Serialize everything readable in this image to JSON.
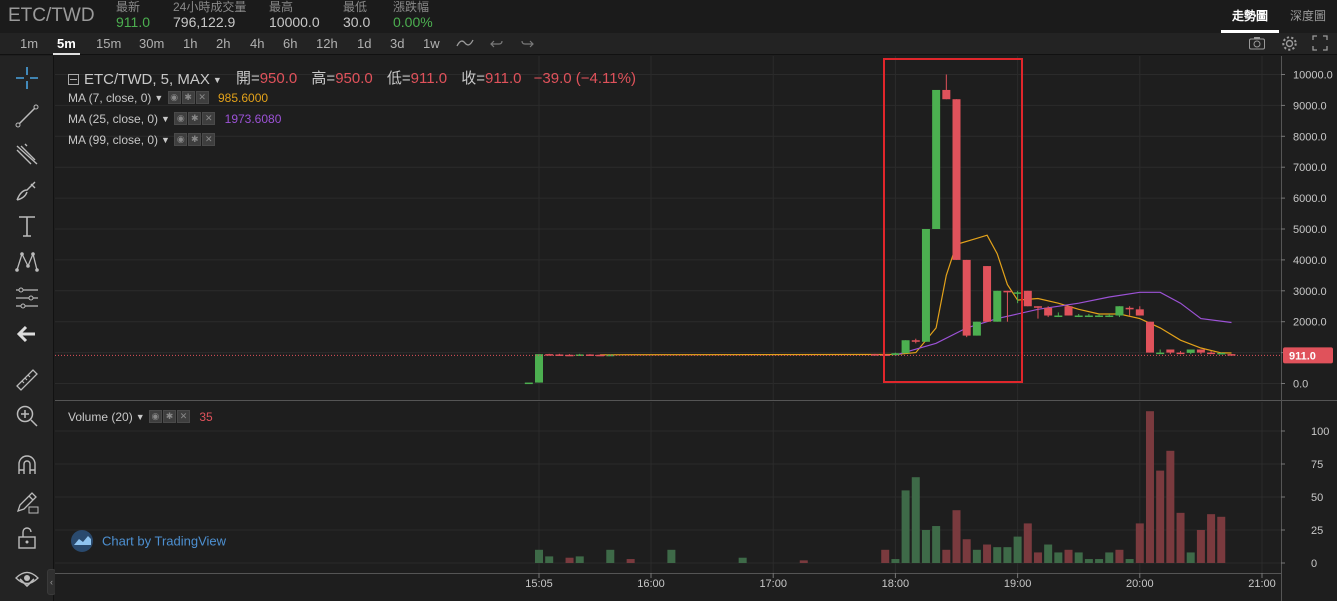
{
  "header": {
    "pair": "ETC/TWD",
    "stats": [
      {
        "label": "最新",
        "value": "911.0",
        "tone": "up"
      },
      {
        "label": "24小時成交量",
        "value": "796,122.9",
        "tone": ""
      },
      {
        "label": "最高",
        "value": "10000.0",
        "tone": ""
      },
      {
        "label": "最低",
        "value": "30.0",
        "tone": ""
      },
      {
        "label": "漲跌幅",
        "value": "0.00%",
        "tone": "up"
      }
    ],
    "view_tabs": [
      "走勢圖",
      "深度圖"
    ],
    "active_view": "走勢圖"
  },
  "toolbar": {
    "timeframes": [
      "1m",
      "5m",
      "15m",
      "30m",
      "1h",
      "2h",
      "4h",
      "6h",
      "12h",
      "1d",
      "3d",
      "1w"
    ],
    "active_timeframe": "5m"
  },
  "left_tools": [
    "crosshair-icon",
    "trend-line-icon",
    "pitchfork-icon",
    "brush-icon",
    "text-icon",
    "pattern-icon",
    "fib-icon",
    "back-arrow-icon",
    "ruler-icon",
    "zoom-in-icon",
    "magnet-icon",
    "lock-pencil-icon",
    "unlock-icon",
    "eye-icon"
  ],
  "legend": {
    "title": "ETC/TWD, 5, MAX",
    "open_label": "開=",
    "open": "950.0",
    "high_label": "高=",
    "high": "950.0",
    "low_label": "低=",
    "low": "911.0",
    "close_label": "收=",
    "close": "911.0",
    "change": "−39.0 (−4.11%)",
    "ma7_label": "MA (7, close, 0)",
    "ma7_value": "985.6000",
    "ma25_label": "MA (25, close, 0)",
    "ma25_value": "1973.6080",
    "ma99_label": "MA (99, close, 0)",
    "volume_label": "Volume (20)",
    "volume_value": "35"
  },
  "watermark": "Chart by TradingView",
  "colors": {
    "up": "#4caf50",
    "down": "#e0525b",
    "ma7": "#e3a21a",
    "ma25": "#9c52d6",
    "up_vol": "#3e6a48",
    "down_vol": "#7a3a3e",
    "highlight": "#e0262b"
  },
  "chart_data": {
    "type": "candlestick",
    "price_axis": {
      "ticks": [
        0,
        1000,
        2000,
        3000,
        4000,
        5000,
        6000,
        7000,
        8000,
        9000,
        10000
      ],
      "tick_labels": [
        "0.0",
        "1000.0",
        "2000.0",
        "3000.0",
        "4000.0",
        "5000.0",
        "6000.0",
        "7000.0",
        "8000.0",
        "9000.0",
        "10000.0"
      ],
      "last_price": "911.0"
    },
    "volume_axis": {
      "ticks": [
        0,
        25,
        50,
        75,
        100
      ],
      "tick_labels": [
        "0",
        "25",
        "50",
        "75",
        "100"
      ]
    },
    "time_axis": {
      "ticks": [
        "15:05",
        "16:00",
        "17:00",
        "18:00",
        "19:00",
        "20:00",
        "21:00"
      ],
      "tick_minutes": [
        905,
        960,
        1020,
        1080,
        1140,
        1200,
        1260
      ]
    },
    "candles": [
      {
        "t": 900,
        "o": 30,
        "h": 30,
        "l": 30,
        "c": 30
      },
      {
        "t": 905,
        "o": 30,
        "h": 950,
        "l": 30,
        "c": 950
      },
      {
        "t": 910,
        "o": 950,
        "h": 960,
        "l": 900,
        "c": 940
      },
      {
        "t": 915,
        "o": 940,
        "h": 960,
        "l": 920,
        "c": 930
      },
      {
        "t": 920,
        "o": 930,
        "h": 950,
        "l": 900,
        "c": 920
      },
      {
        "t": 925,
        "o": 920,
        "h": 960,
        "l": 910,
        "c": 940
      },
      {
        "t": 930,
        "o": 940,
        "h": 950,
        "l": 920,
        "c": 930
      },
      {
        "t": 935,
        "o": 930,
        "h": 940,
        "l": 920,
        "c": 925
      },
      {
        "t": 940,
        "o": 925,
        "h": 935,
        "l": 915,
        "c": 930
      },
      {
        "t": 1070,
        "o": 950,
        "h": 960,
        "l": 930,
        "c": 940
      },
      {
        "t": 1075,
        "o": 940,
        "h": 950,
        "l": 910,
        "c": 920
      },
      {
        "t": 1080,
        "o": 920,
        "h": 1000,
        "l": 920,
        "c": 980
      },
      {
        "t": 1085,
        "o": 980,
        "h": 1400,
        "l": 980,
        "c": 1400
      },
      {
        "t": 1090,
        "o": 1400,
        "h": 1450,
        "l": 1300,
        "c": 1350
      },
      {
        "t": 1095,
        "o": 1350,
        "h": 5000,
        "l": 1350,
        "c": 5000
      },
      {
        "t": 1100,
        "o": 5000,
        "h": 9500,
        "l": 5000,
        "c": 9500
      },
      {
        "t": 1105,
        "o": 9500,
        "h": 10000,
        "l": 9200,
        "c": 9200
      },
      {
        "t": 1110,
        "o": 9200,
        "h": 9200,
        "l": 4000,
        "c": 4000
      },
      {
        "t": 1115,
        "o": 4000,
        "h": 4000,
        "l": 1500,
        "c": 1550
      },
      {
        "t": 1120,
        "o": 1550,
        "h": 2000,
        "l": 1550,
        "c": 2000
      },
      {
        "t": 1125,
        "o": 3800,
        "h": 3800,
        "l": 2000,
        "c": 2000
      },
      {
        "t": 1130,
        "o": 2000,
        "h": 3000,
        "l": 2000,
        "c": 3000
      },
      {
        "t": 1135,
        "o": 3000,
        "h": 3000,
        "l": 2000,
        "c": 2950
      },
      {
        "t": 1140,
        "o": 2950,
        "h": 3000,
        "l": 2600,
        "c": 2950
      },
      {
        "t": 1145,
        "o": 3000,
        "h": 3000,
        "l": 2500,
        "c": 2500
      },
      {
        "t": 1150,
        "o": 2500,
        "h": 2500,
        "l": 2100,
        "c": 2450
      },
      {
        "t": 1155,
        "o": 2450,
        "h": 2500,
        "l": 2150,
        "c": 2200
      },
      {
        "t": 1160,
        "o": 2200,
        "h": 2300,
        "l": 2150,
        "c": 2200
      },
      {
        "t": 1165,
        "o": 2500,
        "h": 2500,
        "l": 2200,
        "c": 2200
      },
      {
        "t": 1170,
        "o": 2200,
        "h": 2250,
        "l": 2150,
        "c": 2200
      },
      {
        "t": 1175,
        "o": 2200,
        "h": 2250,
        "l": 2150,
        "c": 2200
      },
      {
        "t": 1180,
        "o": 2200,
        "h": 2250,
        "l": 2150,
        "c": 2200
      },
      {
        "t": 1185,
        "o": 2200,
        "h": 2250,
        "l": 2150,
        "c": 2200
      },
      {
        "t": 1190,
        "o": 2200,
        "h": 2500,
        "l": 2150,
        "c": 2500
      },
      {
        "t": 1195,
        "o": 2450,
        "h": 2500,
        "l": 2200,
        "c": 2400
      },
      {
        "t": 1200,
        "o": 2400,
        "h": 2500,
        "l": 2200,
        "c": 2200
      },
      {
        "t": 1205,
        "o": 2000,
        "h": 2000,
        "l": 1000,
        "c": 1000
      },
      {
        "t": 1210,
        "o": 1000,
        "h": 1100,
        "l": 950,
        "c": 1000
      },
      {
        "t": 1215,
        "o": 1100,
        "h": 1100,
        "l": 950,
        "c": 1000
      },
      {
        "t": 1220,
        "o": 1000,
        "h": 1050,
        "l": 950,
        "c": 990
      },
      {
        "t": 1225,
        "o": 990,
        "h": 1100,
        "l": 950,
        "c": 1100
      },
      {
        "t": 1230,
        "o": 1100,
        "h": 1100,
        "l": 950,
        "c": 1000
      },
      {
        "t": 1235,
        "o": 1000,
        "h": 1050,
        "l": 950,
        "c": 980
      },
      {
        "t": 1240,
        "o": 980,
        "h": 1000,
        "l": 950,
        "c": 990
      },
      {
        "t": 1245,
        "o": 950,
        "h": 950,
        "l": 911,
        "c": 911
      }
    ],
    "volume": [
      {
        "t": 905,
        "v": 10,
        "dir": "up"
      },
      {
        "t": 910,
        "v": 5,
        "dir": "up"
      },
      {
        "t": 920,
        "v": 4,
        "dir": "down"
      },
      {
        "t": 925,
        "v": 5,
        "dir": "up"
      },
      {
        "t": 940,
        "v": 10,
        "dir": "up"
      },
      {
        "t": 950,
        "v": 3,
        "dir": "down"
      },
      {
        "t": 970,
        "v": 10,
        "dir": "up"
      },
      {
        "t": 1005,
        "v": 4,
        "dir": "up"
      },
      {
        "t": 1035,
        "v": 2,
        "dir": "down"
      },
      {
        "t": 1075,
        "v": 10,
        "dir": "down"
      },
      {
        "t": 1080,
        "v": 3,
        "dir": "up"
      },
      {
        "t": 1085,
        "v": 55,
        "dir": "up"
      },
      {
        "t": 1090,
        "v": 65,
        "dir": "up"
      },
      {
        "t": 1095,
        "v": 25,
        "dir": "up"
      },
      {
        "t": 1100,
        "v": 28,
        "dir": "up"
      },
      {
        "t": 1105,
        "v": 10,
        "dir": "down"
      },
      {
        "t": 1110,
        "v": 40,
        "dir": "down"
      },
      {
        "t": 1115,
        "v": 18,
        "dir": "down"
      },
      {
        "t": 1120,
        "v": 10,
        "dir": "up"
      },
      {
        "t": 1125,
        "v": 14,
        "dir": "down"
      },
      {
        "t": 1130,
        "v": 12,
        "dir": "up"
      },
      {
        "t": 1135,
        "v": 12,
        "dir": "up"
      },
      {
        "t": 1140,
        "v": 20,
        "dir": "up"
      },
      {
        "t": 1145,
        "v": 30,
        "dir": "down"
      },
      {
        "t": 1150,
        "v": 8,
        "dir": "down"
      },
      {
        "t": 1155,
        "v": 14,
        "dir": "up"
      },
      {
        "t": 1160,
        "v": 8,
        "dir": "up"
      },
      {
        "t": 1165,
        "v": 10,
        "dir": "down"
      },
      {
        "t": 1170,
        "v": 8,
        "dir": "up"
      },
      {
        "t": 1175,
        "v": 3,
        "dir": "up"
      },
      {
        "t": 1180,
        "v": 3,
        "dir": "up"
      },
      {
        "t": 1185,
        "v": 8,
        "dir": "up"
      },
      {
        "t": 1190,
        "v": 10,
        "dir": "down"
      },
      {
        "t": 1195,
        "v": 3,
        "dir": "up"
      },
      {
        "t": 1200,
        "v": 30,
        "dir": "down"
      },
      {
        "t": 1205,
        "v": 115,
        "dir": "down"
      },
      {
        "t": 1210,
        "v": 70,
        "dir": "down"
      },
      {
        "t": 1215,
        "v": 85,
        "dir": "down"
      },
      {
        "t": 1220,
        "v": 38,
        "dir": "down"
      },
      {
        "t": 1225,
        "v": 8,
        "dir": "up"
      },
      {
        "t": 1230,
        "v": 25,
        "dir": "down"
      },
      {
        "t": 1235,
        "v": 37,
        "dir": "down"
      },
      {
        "t": 1240,
        "v": 35,
        "dir": "down"
      }
    ],
    "ma7": [
      [
        935,
        930
      ],
      [
        1060,
        940
      ],
      [
        1080,
        940
      ],
      [
        1090,
        1000
      ],
      [
        1100,
        1800
      ],
      [
        1105,
        3500
      ],
      [
        1110,
        4500
      ],
      [
        1120,
        4700
      ],
      [
        1125,
        4800
      ],
      [
        1130,
        4200
      ],
      [
        1135,
        3200
      ],
      [
        1140,
        2700
      ],
      [
        1150,
        2750
      ],
      [
        1160,
        2600
      ],
      [
        1170,
        2400
      ],
      [
        1180,
        2250
      ],
      [
        1190,
        2250
      ],
      [
        1200,
        2100
      ],
      [
        1210,
        1800
      ],
      [
        1220,
        1400
      ],
      [
        1230,
        1150
      ],
      [
        1240,
        990
      ],
      [
        1245,
        986
      ]
    ],
    "ma25": [
      [
        1080,
        920
      ],
      [
        1100,
        1300
      ],
      [
        1115,
        1800
      ],
      [
        1130,
        2100
      ],
      [
        1150,
        2400
      ],
      [
        1170,
        2600
      ],
      [
        1185,
        2800
      ],
      [
        1200,
        2950
      ],
      [
        1210,
        2950
      ],
      [
        1220,
        2600
      ],
      [
        1230,
        2100
      ],
      [
        1245,
        1974
      ]
    ]
  }
}
